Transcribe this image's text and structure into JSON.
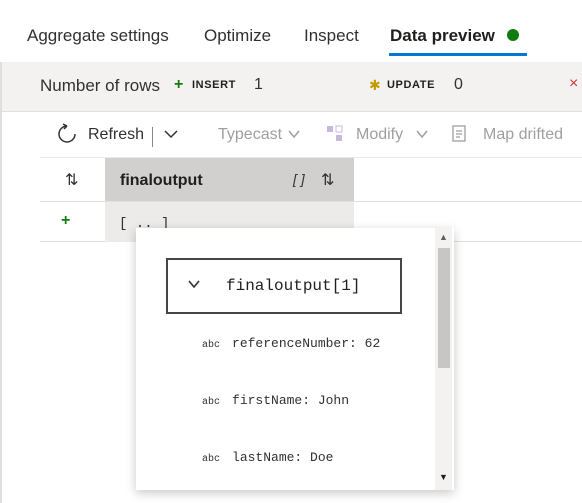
{
  "tabs": [
    {
      "label": "Aggregate settings"
    },
    {
      "label": "Optimize"
    },
    {
      "label": "Inspect"
    },
    {
      "label": "Data preview",
      "active": true
    }
  ],
  "counts": {
    "title": "Number of rows",
    "insert_label": "INSERT",
    "insert_value": "1",
    "update_label": "UPDATE",
    "update_value": "0"
  },
  "toolbar": {
    "refresh": "Refresh",
    "typecast": "Typecast",
    "modify": "Modify",
    "map_drifted": "Map drifted"
  },
  "grid": {
    "column": "finaloutput",
    "column_type_marker": "[ ]",
    "row_value": "[ .. ]"
  },
  "popup": {
    "node_title": "finaloutput[1]",
    "fields": [
      {
        "type": "abc",
        "text": "referenceNumber: 62"
      },
      {
        "type": "abc",
        "text": "firstName: John"
      },
      {
        "type": "abc",
        "text": "lastName: Doe"
      }
    ]
  },
  "colors": {
    "accent": "#0078d4",
    "status_ok": "#107c10",
    "update_star": "#c19c00",
    "delete_x": "#d13438"
  }
}
